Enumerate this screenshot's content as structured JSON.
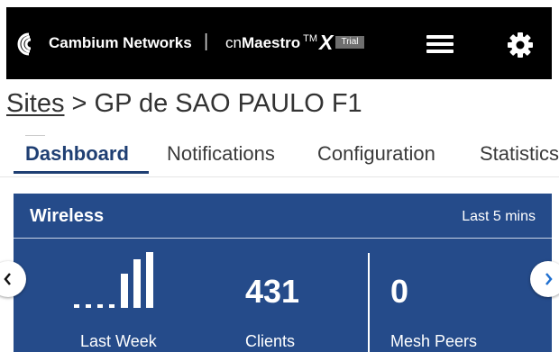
{
  "header": {
    "brand": "Cambium Networks",
    "separator": "|",
    "product_prefix": "cn",
    "product_name": "Maestro",
    "trademark": "TM",
    "product_suffix": "X",
    "trial_badge": "Trial"
  },
  "breadcrumb": {
    "root": "Sites",
    "separator": " > ",
    "current": "GP de SAO PAULO F1"
  },
  "tabs": [
    {
      "label": "Dashboard",
      "active": true
    },
    {
      "label": "Notifications",
      "active": false
    },
    {
      "label": "Configuration",
      "active": false
    },
    {
      "label": "Statistics",
      "active": false
    }
  ],
  "wireless_card": {
    "title": "Wireless",
    "range": "Last 5 mins",
    "stats": [
      {
        "label": "Last Week"
      },
      {
        "value": "431",
        "label": "Clients"
      },
      {
        "value": "0",
        "label": "Mesh Peers"
      }
    ]
  },
  "colors": {
    "topbar": "#000000",
    "accent": "#1f3f73",
    "card": "#254b8a"
  }
}
